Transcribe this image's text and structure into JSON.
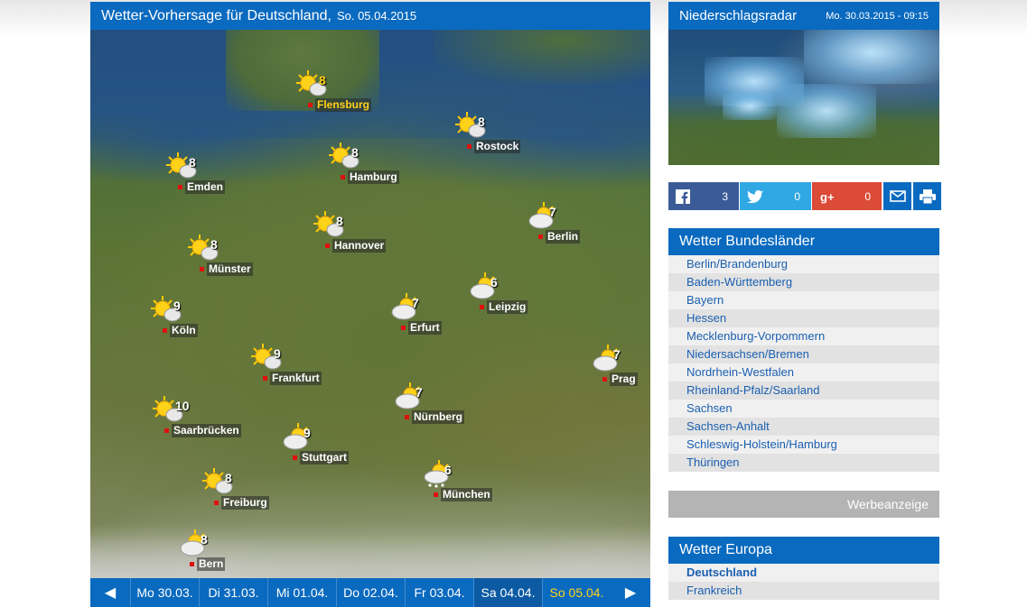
{
  "map": {
    "title": "Wetter-Vorhersage für Deutschland,",
    "date": "So. 05.04.2015",
    "cities": [
      {
        "name": "Flensburg",
        "temp": "8",
        "icon": "sun-cloud-icon",
        "highlight": true
      },
      {
        "name": "Rostock",
        "temp": "8",
        "icon": "sun-cloud-icon"
      },
      {
        "name": "Emden",
        "temp": "8",
        "icon": "sun-cloud-icon"
      },
      {
        "name": "Hamburg",
        "temp": "8",
        "icon": "sun-cloud-icon"
      },
      {
        "name": "Berlin",
        "temp": "7",
        "icon": "cloud-sun-icon"
      },
      {
        "name": "Hannover",
        "temp": "8",
        "icon": "sun-cloud-icon"
      },
      {
        "name": "Münster",
        "temp": "8",
        "icon": "sun-cloud-icon"
      },
      {
        "name": "Leipzig",
        "temp": "6",
        "icon": "cloud-sun-icon"
      },
      {
        "name": "Köln",
        "temp": "9",
        "icon": "sun-cloud-icon"
      },
      {
        "name": "Erfurt",
        "temp": "7",
        "icon": "cloud-sun-icon"
      },
      {
        "name": "Prag",
        "temp": "7",
        "icon": "cloud-sun-icon"
      },
      {
        "name": "Frankfurt",
        "temp": "9",
        "icon": "sun-cloud-icon"
      },
      {
        "name": "Nürnberg",
        "temp": "7",
        "icon": "cloud-sun-icon"
      },
      {
        "name": "Saarbrücken",
        "temp": "10",
        "icon": "sun-cloud-icon"
      },
      {
        "name": "Stuttgart",
        "temp": "9",
        "icon": "cloud-sun-icon"
      },
      {
        "name": "München",
        "temp": "6",
        "icon": "cloud-snow-icon"
      },
      {
        "name": "Freiburg",
        "temp": "8",
        "icon": "sun-cloud-icon"
      },
      {
        "name": "Bern",
        "temp": "8",
        "icon": "cloud-sun-icon"
      }
    ],
    "days": [
      {
        "label": "Mo 30.03."
      },
      {
        "label": "Di 31.03."
      },
      {
        "label": "Mi 01.04."
      },
      {
        "label": "Do 02.04."
      },
      {
        "label": "Fr 03.04."
      },
      {
        "label": "Sa 04.04."
      },
      {
        "label": "So 05.04.",
        "active": true
      }
    ],
    "prev_icon": "◀",
    "next_icon": "▶"
  },
  "radar": {
    "title": "Niederschlagsradar",
    "time": "Mo. 30.03.2015 - 09:15"
  },
  "share": {
    "facebook_count": "3",
    "twitter_count": "0",
    "googleplus_count": "0"
  },
  "bundeslaender": {
    "title": "Wetter Bundesländer",
    "items": [
      "Berlin/Brandenburg",
      "Baden-Württemberg",
      "Bayern",
      "Hessen",
      "Mecklenburg-Vorpommern",
      "Niedersachsen/Bremen",
      "Nordrhein-Westfalen",
      "Rheinland-Pfalz/Saarland",
      "Sachsen",
      "Sachsen-Anhalt",
      "Schleswig-Holstein/Hamburg",
      "Thüringen"
    ]
  },
  "ad": {
    "label": "Werbeanzeige"
  },
  "europa": {
    "title": "Wetter Europa",
    "items": [
      "Deutschland",
      "Frankreich"
    ]
  },
  "colors": {
    "brand_blue": "#0a6abf",
    "highlight": "#ffd21a",
    "link": "#1a5fb0"
  }
}
